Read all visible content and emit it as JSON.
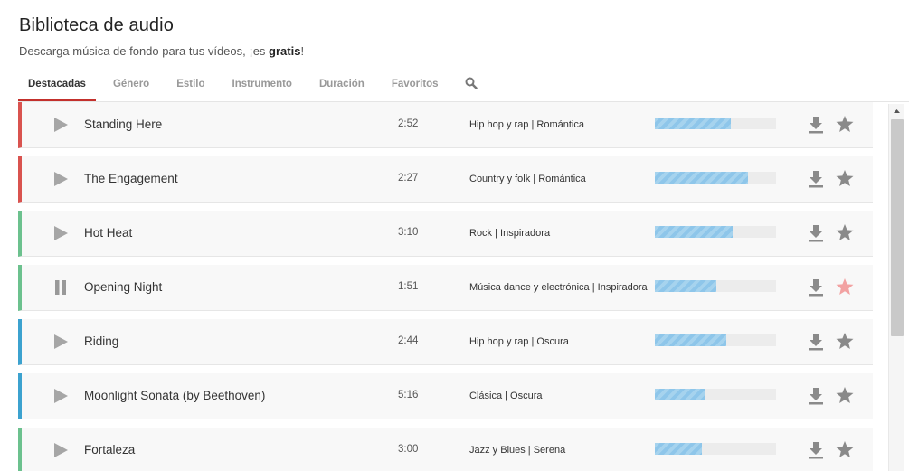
{
  "header": {
    "title": "Biblioteca de audio",
    "subtitle_prefix": "Descarga música de fondo para tus vídeos, ¡es ",
    "subtitle_bold": "gratis",
    "subtitle_suffix": "!"
  },
  "tabs": [
    {
      "label": "Destacadas",
      "active": true
    },
    {
      "label": "Género",
      "active": false
    },
    {
      "label": "Estilo",
      "active": false
    },
    {
      "label": "Instrumento",
      "active": false
    },
    {
      "label": "Duración",
      "active": false
    },
    {
      "label": "Favoritos",
      "active": false
    }
  ],
  "search_icon": "search-icon",
  "colors": {
    "red": "#d9534f",
    "green": "#6cc18e",
    "blue": "#3ca2cf",
    "accent": "#c3302c",
    "star_active": "#f2a2a2",
    "icon_gray": "#999999"
  },
  "tracks": [
    {
      "name": "Standing Here",
      "duration": "2:52",
      "genre": "Hip hop y rap | Romántica",
      "popularity": 0.63,
      "state": "play",
      "favorite": false,
      "stripe": "red"
    },
    {
      "name": "The Engagement",
      "duration": "2:27",
      "genre": "Country y folk | Romántica",
      "popularity": 0.77,
      "state": "play",
      "favorite": false,
      "stripe": "red"
    },
    {
      "name": "Hot Heat",
      "duration": "3:10",
      "genre": "Rock | Inspiradora",
      "popularity": 0.64,
      "state": "play",
      "favorite": false,
      "stripe": "green"
    },
    {
      "name": "Opening Night",
      "duration": "1:51",
      "genre": "Música dance y electrónica | Inspiradora",
      "popularity": 0.51,
      "state": "pause",
      "favorite": true,
      "stripe": "green"
    },
    {
      "name": "Riding",
      "duration": "2:44",
      "genre": "Hip hop y rap | Oscura",
      "popularity": 0.59,
      "state": "play",
      "favorite": false,
      "stripe": "blue"
    },
    {
      "name": "Moonlight Sonata (by Beethoven)",
      "duration": "5:16",
      "genre": "Clásica | Oscura",
      "popularity": 0.41,
      "state": "play",
      "favorite": false,
      "stripe": "blue"
    },
    {
      "name": "Fortaleza",
      "duration": "3:00",
      "genre": "Jazz y Blues | Serena",
      "popularity": 0.39,
      "state": "play",
      "favorite": false,
      "stripe": "green"
    }
  ]
}
